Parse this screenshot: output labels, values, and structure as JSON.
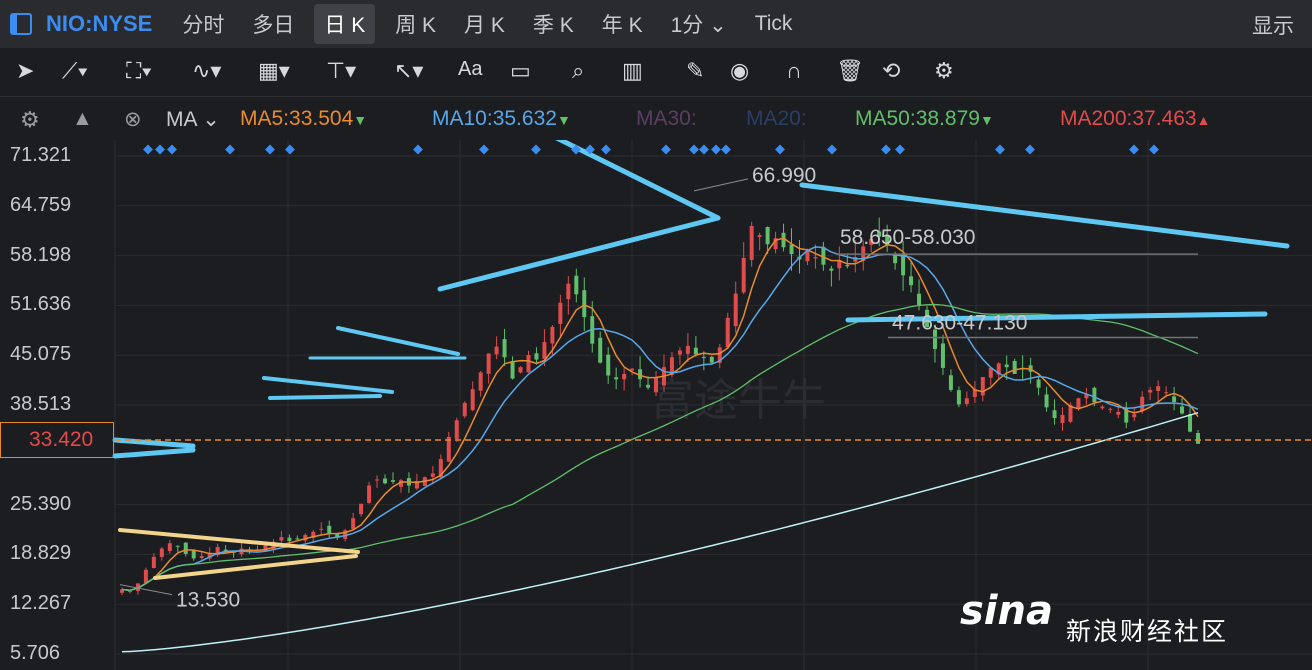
{
  "topbar": {
    "symbol": "NIO:NYSE",
    "tabs": [
      "分时",
      "多日",
      "日 K",
      "周 K",
      "月 K",
      "季 K",
      "年 K",
      "1分",
      "Tick"
    ],
    "active_tab": "日 K",
    "display_label": "显示"
  },
  "toolbar": {
    "icons": [
      "cursor-icon",
      "line-tool-icon",
      "path-tool-icon",
      "wave-tool-icon",
      "fib-tool-icon",
      "horizontal-line-icon",
      "arrow-tool-icon",
      "text-tool-icon",
      "comment-icon",
      "zoom-icon",
      "indicator-icon",
      "pen-icon",
      "eye-icon",
      "magnet-icon",
      "trash-icon",
      "sync-icon",
      "settings-icon"
    ],
    "text_tool_label": "Aa"
  },
  "ma_bar": {
    "selector": "MA",
    "items": [
      {
        "label": "MA5:33.504",
        "color": "#e98b2e",
        "arrow": "▼"
      },
      {
        "label": "MA10:35.632",
        "color": "#57a8e8",
        "arrow": "▼"
      },
      {
        "label": "MA30:",
        "color": "#5a3f60",
        "arrow": ""
      },
      {
        "label": "MA20:",
        "color": "#2a3f66",
        "arrow": ""
      },
      {
        "label": "MA50:38.879",
        "color": "#5fbf6a",
        "arrow": "▼"
      },
      {
        "label": "MA200:37.463",
        "color": "#e14b4b",
        "arrow": "▲"
      }
    ]
  },
  "chart_data": {
    "type": "candlestick",
    "y_ticks": [
      "71.321",
      "64.759",
      "58.198",
      "51.636",
      "45.075",
      "38.513",
      "33.420",
      "25.390",
      "18.829",
      "12.267",
      "5.706"
    ],
    "current_price": "33.420",
    "ylim": [
      5.706,
      71.321
    ],
    "annotations": [
      {
        "text": "66.990",
        "price": 66.99
      },
      {
        "text": "13.530",
        "price": 13.53
      },
      {
        "text": "58.650-58.030",
        "price": 58.4
      },
      {
        "text": "47.630-47.130",
        "price": 47.4
      }
    ],
    "close_series": [
      14.2,
      14.0,
      15.0,
      16.8,
      18.5,
      19.6,
      20.3,
      19.9,
      18.9,
      18.3,
      18.6,
      19.0,
      19.8,
      19.3,
      19.1,
      19.6,
      19.2,
      19.5,
      20.0,
      20.5,
      21.1,
      20.6,
      20.9,
      21.4,
      21.8,
      22.2,
      21.5,
      21.0,
      22.0,
      23.6,
      25.5,
      27.9,
      28.7,
      28.2,
      28.4,
      28.6,
      27.9,
      28.5,
      29.0,
      29.5,
      31.4,
      34.3,
      36.5,
      38.8,
      40.6,
      42.8,
      45.3,
      46.2,
      44.8,
      42.0,
      43.5,
      45.1,
      44.5,
      46.8,
      48.8,
      52.0,
      54.5,
      53.1,
      50.1,
      46.6,
      44.1,
      42.4,
      41.9,
      42.6,
      43.3,
      41.9,
      40.8,
      42.1,
      43.5,
      44.8,
      45.7,
      46.3,
      45.2,
      44.7,
      44.1,
      46.1,
      50.0,
      53.2,
      57.9,
      62.1,
      60.9,
      59.7,
      60.5,
      59.3,
      58.4,
      57.7,
      58.9,
      58.0,
      57.0,
      56.2,
      57.6,
      56.8,
      58.0,
      59.4,
      60.4,
      60.7,
      59.6,
      57.2,
      55.6,
      54.3,
      51.7,
      48.8,
      45.9,
      43.4,
      40.5,
      38.6,
      39.4,
      40.6,
      42.2,
      43.4,
      44.0,
      43.5,
      42.6,
      43.2,
      42.9,
      40.8,
      38.2,
      36.8,
      37.2,
      38.5,
      39.4,
      39.9,
      38.9,
      38.3,
      38.0,
      37.6,
      36.2,
      37.3,
      39.6,
      40.5,
      41.0,
      40.2,
      38.9,
      37.4,
      35.0,
      33.4
    ],
    "ma_lines": [
      "MA5",
      "MA10",
      "MA50",
      "MA200"
    ],
    "trend_lines": "hand-drawn triangle / channel annotations"
  },
  "watermark": "富途牛牛",
  "brand": {
    "logo": "sina",
    "text": "新浪财经社区"
  }
}
